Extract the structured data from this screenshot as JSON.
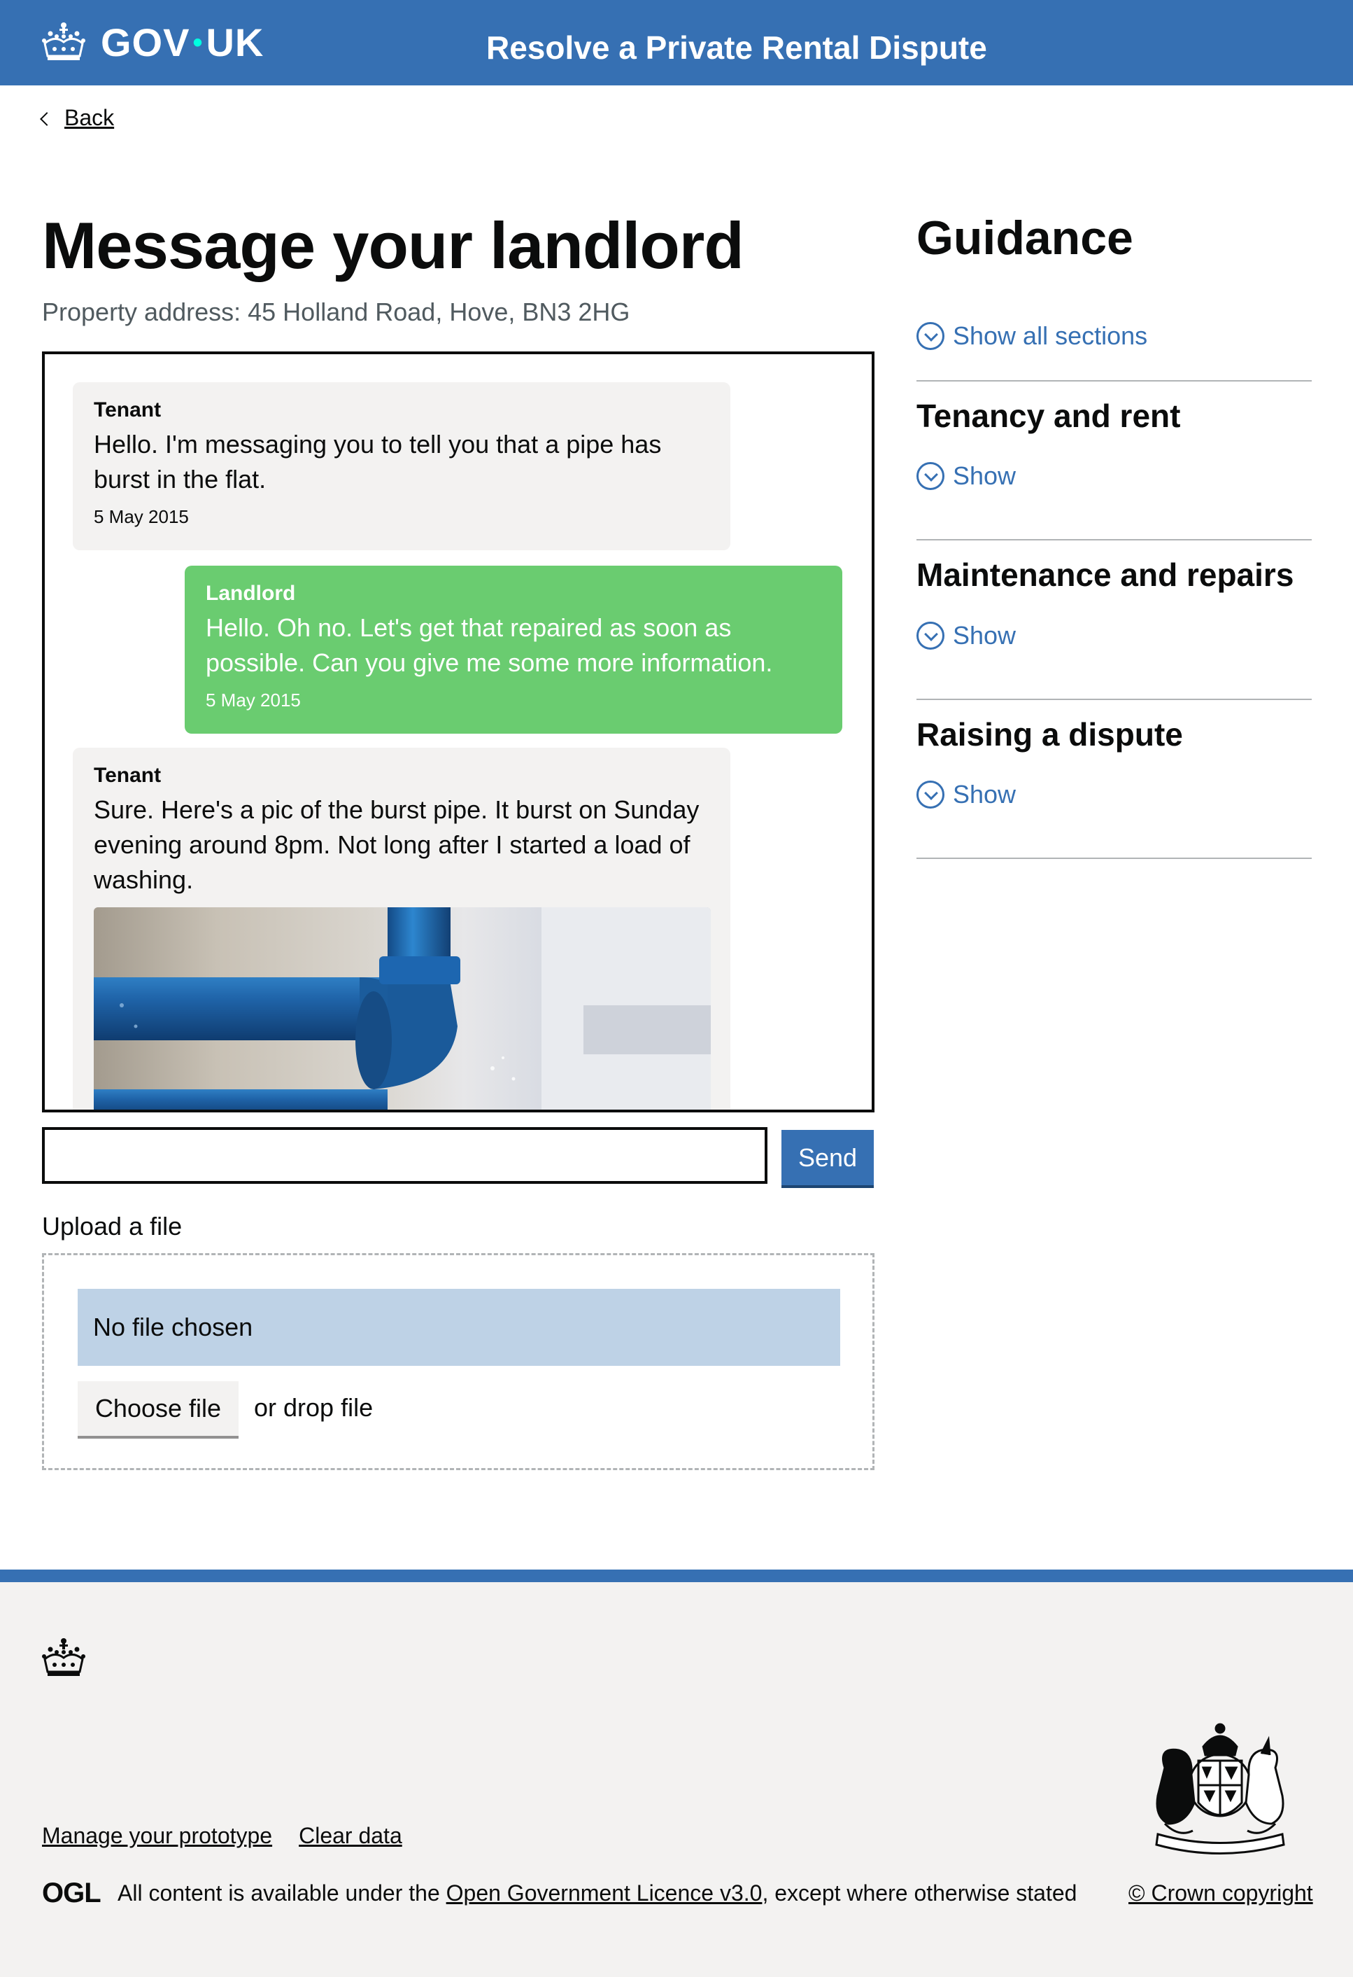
{
  "header": {
    "logo_text_left": "GOV",
    "logo_dot": "•",
    "logo_text_right": "UK",
    "service_name": "Resolve a Private Rental Dispute",
    "brand_color": "#3670b3"
  },
  "back_link": {
    "label": "Back"
  },
  "main": {
    "title": "Message your landlord",
    "property_address": "Property address: 45 Holland Road, Hove, BN3 2HG"
  },
  "messages": [
    {
      "author": "Tenant",
      "text": "Hello. I'm messaging you to tell you that a pipe has burst in the flat.",
      "date": "5 May 2015",
      "color": "#f3f2f1"
    },
    {
      "author": "Landlord",
      "text": "Hello. Oh no. Let's get that repaired as soon as possible. Can you give me some more information.",
      "date": "5 May 2015",
      "color": "#6acc70"
    },
    {
      "author": "Tenant",
      "text": "Sure. Here's a pic of the burst pipe. It burst on Sunday evening around 8pm. Not long after I started a load of washing.",
      "color": "#f3f2f1"
    }
  ],
  "compose": {
    "input_value": "",
    "send_label": "Send"
  },
  "upload": {
    "label": "Upload a file",
    "status": "No file chosen",
    "choose_label": "Choose file",
    "drop_text": "or drop file"
  },
  "guidance": {
    "title": "Guidance",
    "show_all_label": "Show all sections",
    "sections": [
      {
        "title": "Tenancy and rent",
        "show_label": "Show"
      },
      {
        "title": "Maintenance and repairs",
        "show_label": "Show"
      },
      {
        "title": "Raising a dispute",
        "show_label": "Show"
      }
    ]
  },
  "footer": {
    "links": [
      "Manage your prototype",
      "Clear data"
    ],
    "ogl_logo": "OGL",
    "licence_prefix": "All content is available under the ",
    "licence_link": "Open Government Licence v3.0",
    "licence_suffix": ", except where otherwise stated",
    "copyright": "© Crown copyright"
  }
}
